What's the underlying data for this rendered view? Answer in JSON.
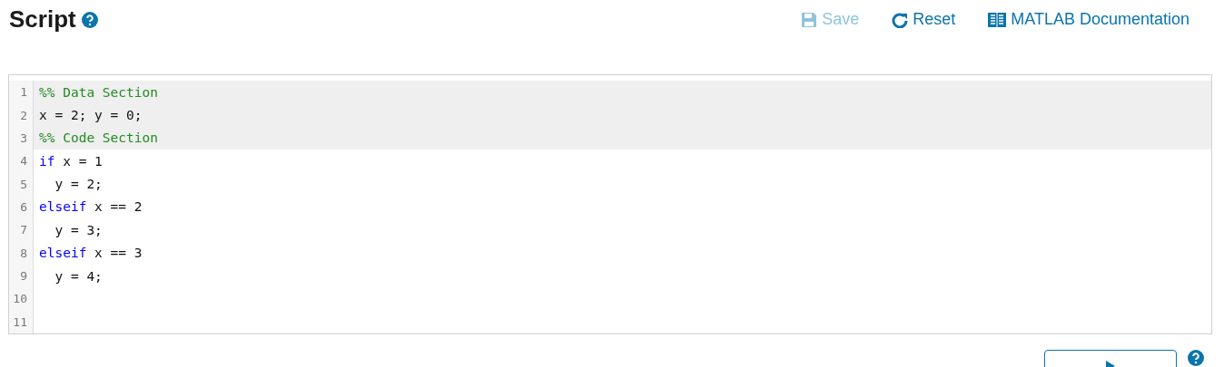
{
  "title": "Script",
  "toolbar": [
    {
      "kind": "save",
      "label": "Save",
      "disabled": true
    },
    {
      "kind": "reset",
      "label": "Reset",
      "disabled": false
    },
    {
      "kind": "docs",
      "label": "MATLAB Documentation",
      "disabled": false
    }
  ],
  "editor": {
    "lines": [
      {
        "number": "1",
        "highlighted": true,
        "tokens": [
          {
            "kind": "comment",
            "text": "%% Data Section"
          }
        ]
      },
      {
        "number": "2",
        "highlighted": true,
        "tokens": [
          {
            "kind": "plain",
            "text": "x = 2; y = 0;"
          }
        ]
      },
      {
        "number": "3",
        "highlighted": true,
        "tokens": [
          {
            "kind": "comment",
            "text": "%% Code Section"
          }
        ]
      },
      {
        "number": "4",
        "highlighted": false,
        "tokens": [
          {
            "kind": "keyword",
            "text": "if"
          },
          {
            "kind": "plain",
            "text": " x = 1"
          }
        ]
      },
      {
        "number": "5",
        "highlighted": false,
        "tokens": [
          {
            "kind": "plain",
            "text": "  y = 2;"
          }
        ]
      },
      {
        "number": "6",
        "highlighted": false,
        "tokens": [
          {
            "kind": "keyword",
            "text": "elseif"
          },
          {
            "kind": "plain",
            "text": " x == 2"
          }
        ]
      },
      {
        "number": "7",
        "highlighted": false,
        "tokens": [
          {
            "kind": "plain",
            "text": "  y = 3;"
          }
        ]
      },
      {
        "number": "8",
        "highlighted": false,
        "tokens": [
          {
            "kind": "keyword",
            "text": "elseif"
          },
          {
            "kind": "plain",
            "text": " x == 3"
          }
        ]
      },
      {
        "number": "9",
        "highlighted": false,
        "tokens": [
          {
            "kind": "plain",
            "text": "  y = 4;"
          }
        ]
      },
      {
        "number": "10",
        "highlighted": false
      },
      {
        "number": "11",
        "highlighted": false
      }
    ]
  }
}
